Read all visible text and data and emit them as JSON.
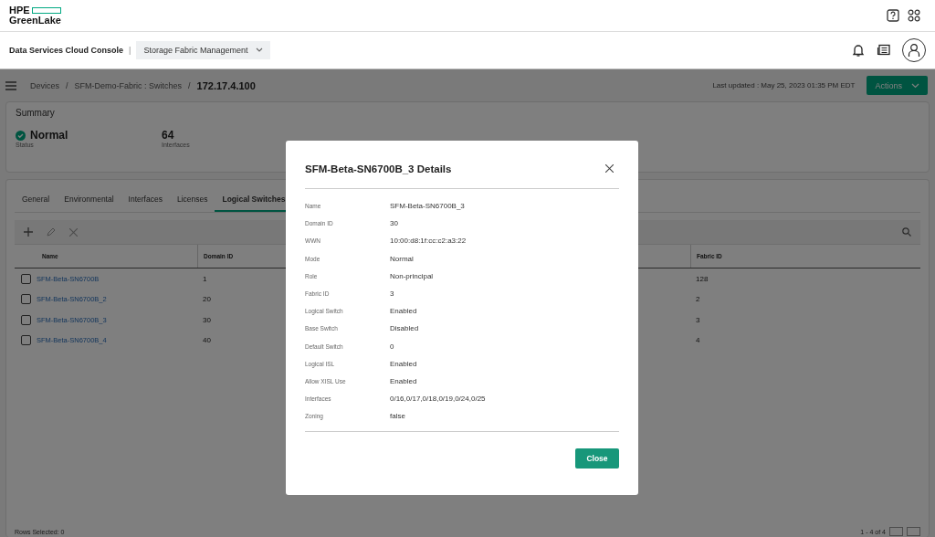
{
  "logo": {
    "lines": [
      "HPE",
      "GreenLake"
    ]
  },
  "nav": {
    "console": "Data Services Cloud Console",
    "separator": "|",
    "service": "Storage Fabric Management"
  },
  "breadcrumb": {
    "items": [
      "Devices",
      "SFM-Demo-Fabric : Switches",
      "172.17.4.100"
    ],
    "separator": "/"
  },
  "last_updated": "Last updated :  May 25, 2023 01:35 PM EDT",
  "actions": "Actions",
  "summary": {
    "title": "Summary",
    "stats": [
      {
        "kind": "status",
        "value": "Normal",
        "label": "Status"
      },
      {
        "kind": "plain",
        "value": "64",
        "label": "Interfaces"
      }
    ]
  },
  "tabs": [
    {
      "label": "General",
      "selected": false
    },
    {
      "label": "Environmental",
      "selected": false
    },
    {
      "label": "Interfaces",
      "selected": false
    },
    {
      "label": "Licenses",
      "selected": false
    },
    {
      "label": "Logical Switches",
      "selected": true
    }
  ],
  "table": {
    "columns": [
      "Name",
      "Domain ID",
      "Fabric ID"
    ],
    "rows": [
      {
        "name": "SFM-Beta-SN6700B",
        "domain_id": "1",
        "fabric_id": "128",
        "checked": false
      },
      {
        "name": "SFM-Beta-SN6700B_2",
        "domain_id": "20",
        "fabric_id": "2",
        "checked": false
      },
      {
        "name": "SFM-Beta-SN6700B_3",
        "domain_id": "30",
        "fabric_id": "3",
        "checked": false
      },
      {
        "name": "SFM-Beta-SN6700B_4",
        "domain_id": "40",
        "fabric_id": "4",
        "checked": false
      }
    ]
  },
  "footer": {
    "rows_selected": "Rows Selected: 0",
    "pager": "1 - 4 of 4"
  },
  "dialog": {
    "title": "SFM-Beta-SN6700B_3 Details",
    "fields": [
      {
        "label": "Name",
        "value": "SFM-Beta-SN6700B_3"
      },
      {
        "label": "Domain ID",
        "value": "30"
      },
      {
        "label": "WWN",
        "value": "10:00:d8:1f:cc:c2:a3:22"
      },
      {
        "label": "Mode",
        "value": "Normal"
      },
      {
        "label": "Role",
        "value": "Non-principal"
      },
      {
        "label": "Fabric ID",
        "value": "3"
      },
      {
        "label": "Logical Switch",
        "value": "Enabled"
      },
      {
        "label": "Base Switch",
        "value": "Disabled"
      },
      {
        "label": "Default Switch",
        "value": "0"
      },
      {
        "label": "Logical ISL",
        "value": "Enabled"
      },
      {
        "label": "Allow XISL Use",
        "value": "Enabled"
      },
      {
        "label": "Interfaces",
        "value": "0/16,0/17,0/18,0/19,0/24,0/25"
      },
      {
        "label": "Zoning",
        "value": "false"
      }
    ],
    "button": "Close"
  }
}
